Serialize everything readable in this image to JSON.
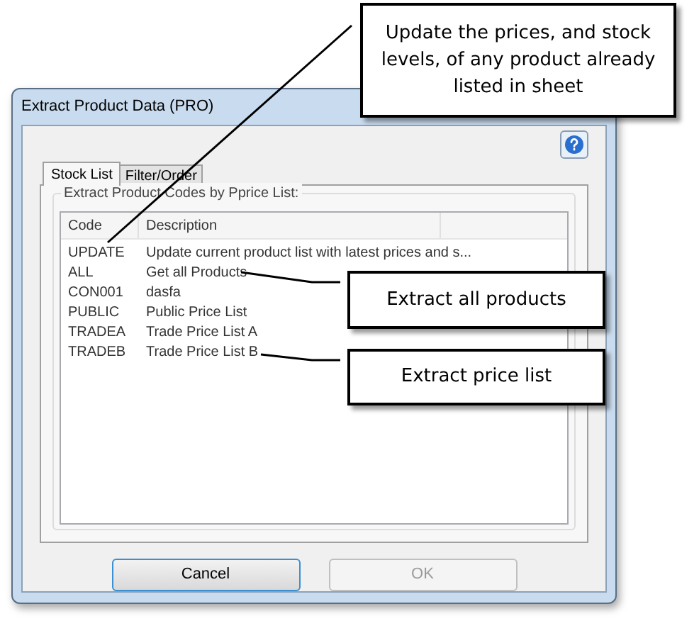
{
  "window": {
    "title": "Extract Product Data (PRO)"
  },
  "tabs": [
    {
      "label": "Stock List",
      "selected": true
    },
    {
      "label": "Filter/Order",
      "selected": false
    }
  ],
  "group": {
    "label": "Extract Product Codes by Pprice List:"
  },
  "list": {
    "columns": [
      "Code",
      "Description"
    ],
    "rows": [
      {
        "code": "UPDATE",
        "description": "Update current product list with latest prices and s..."
      },
      {
        "code": "ALL",
        "description": "Get all Products"
      },
      {
        "code": "CON001",
        "description": "dasfa"
      },
      {
        "code": "PUBLIC",
        "description": "Public Price List"
      },
      {
        "code": "TRADEA",
        "description": "Trade Price List A"
      },
      {
        "code": "TRADEB",
        "description": "Trade Price List B"
      }
    ]
  },
  "buttons": [
    {
      "label": "Cancel",
      "disabled": false
    },
    {
      "label": "OK",
      "disabled": true
    }
  ],
  "callouts": [
    {
      "text": "Update the prices, and stock levels, of any product already listed in sheet"
    },
    {
      "text": "Extract all products"
    },
    {
      "text": "Extract price list"
    }
  ]
}
